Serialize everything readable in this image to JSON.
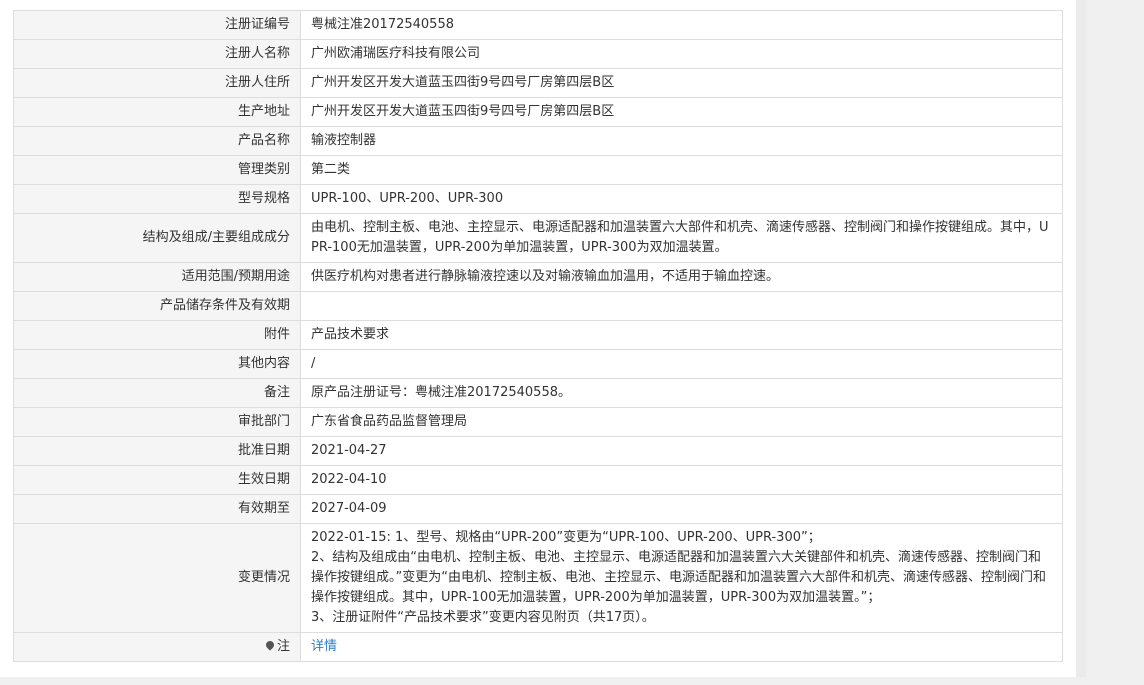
{
  "rows": [
    {
      "label": "注册证编号",
      "value": "粤械注准20172540558"
    },
    {
      "label": "注册人名称",
      "value": "广州欧浦瑞医疗科技有限公司"
    },
    {
      "label": "注册人住所",
      "value": "广州开发区开发大道蓝玉四街9号四号厂房第四层B区"
    },
    {
      "label": "生产地址",
      "value": "广州开发区开发大道蓝玉四街9号四号厂房第四层B区"
    },
    {
      "label": "产品名称",
      "value": "输液控制器"
    },
    {
      "label": "管理类别",
      "value": "第二类"
    },
    {
      "label": "型号规格",
      "value": "UPR-100、UPR-200、UPR-300"
    },
    {
      "label": "结构及组成/主要组成成分",
      "value": "由电机、控制主板、电池、主控显示、电源适配器和加温装置六大部件和机壳、滴速传感器、控制阀门和操作按键组成。其中，UPR-100无加温装置，UPR-200为单加温装置，UPR-300为双加温装置。"
    },
    {
      "label": "适用范围/预期用途",
      "value": "供医疗机构对患者进行静脉输液控速以及对输液输血加温用，不适用于输血控速。"
    },
    {
      "label": "产品储存条件及有效期",
      "value": ""
    },
    {
      "label": "附件",
      "value": "产品技术要求"
    },
    {
      "label": "其他内容",
      "value": "/"
    },
    {
      "label": "备注",
      "value": "原产品注册证号：粤械注准20172540558。"
    },
    {
      "label": "审批部门",
      "value": "广东省食品药品监督管理局"
    },
    {
      "label": "批准日期",
      "value": "2021-04-27"
    },
    {
      "label": "生效日期",
      "value": "2022-04-10"
    },
    {
      "label": "有效期至",
      "value": "2027-04-09"
    }
  ],
  "change": {
    "label": "变更情况",
    "lines": [
      "2022-01-15: 1、型号、规格由“UPR-200”变更为“UPR-100、UPR-200、UPR-300”；",
      "2、结构及组成由“由电机、控制主板、电池、主控显示、电源适配器和加温装置六大关键部件和机壳、滴速传感器、控制阀门和操作按键组成。”变更为“由电机、控制主板、电池、主控显示、电源适配器和加温装置六大部件和机壳、滴速传感器、控制阀门和操作按键组成。其中，UPR-100无加温装置，UPR-200为单加温装置，UPR-300为双加温装置。”；",
      "3、注册证附件“产品技术要求”变更内容见附页（共17页）。"
    ]
  },
  "note": {
    "label": "注",
    "icon": "map-pin-icon",
    "link_text": "详情",
    "link_color": "#2a7ec4"
  }
}
